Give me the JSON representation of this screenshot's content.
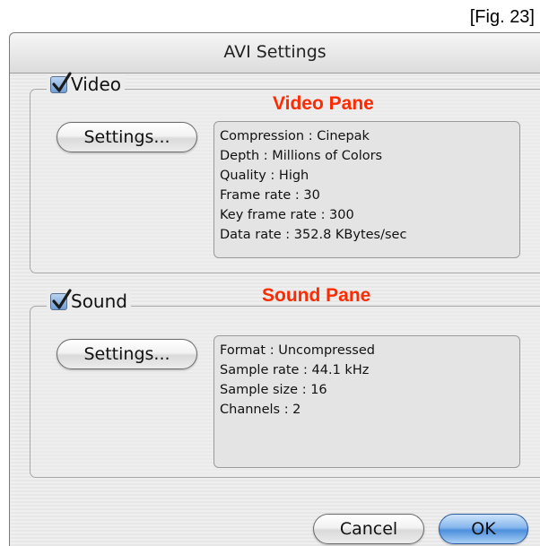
{
  "figure_label": "[Fig. 23]",
  "dialog": {
    "title": "AVI Settings",
    "video": {
      "checkbox_label": "Video",
      "checked": true,
      "pane_note": "Video Pane",
      "settings_button": "Settings...",
      "info": [
        "Compression : Cinepak",
        "Depth : Millions of Colors",
        "Quality : High",
        "Frame rate : 30",
        "Key frame rate : 300",
        "Data rate : 352.8 KBytes/sec"
      ]
    },
    "sound": {
      "checkbox_label": "Sound",
      "checked": true,
      "pane_note": "Sound Pane",
      "settings_button": "Settings...",
      "info": [
        "Format : Uncompressed",
        "Sample rate : 44.1 kHz",
        "Sample size : 16",
        "Channels : 2"
      ]
    },
    "buttons": {
      "cancel": "Cancel",
      "ok": "OK"
    }
  },
  "colors": {
    "annotation_red": "#ff2a00",
    "default_button_blue": "#4d8fdd"
  }
}
